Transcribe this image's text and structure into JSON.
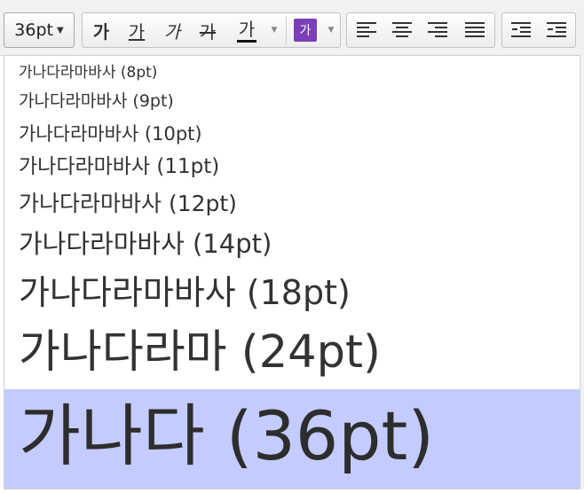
{
  "toolbar": {
    "font_size_value": "36pt",
    "bold_glyph": "가",
    "underline_glyph": "가",
    "italic_glyph": "가",
    "strike_glyph": "가",
    "font_color_glyph": "가",
    "bg_color_glyph": "가",
    "font_color": "#111111",
    "bg_color": "#7a3fb8"
  },
  "size_list": {
    "items": [
      {
        "label": "가나다라마바사 (8pt)",
        "selected": false
      },
      {
        "label": "가나다라마바사 (9pt)",
        "selected": false
      },
      {
        "label": "가나다라마바사 (10pt)",
        "selected": false
      },
      {
        "label": "가나다라마바사 (11pt)",
        "selected": false
      },
      {
        "label": "가나다라마바사 (12pt)",
        "selected": false
      },
      {
        "label": "가나다라마바사 (14pt)",
        "selected": false
      },
      {
        "label": "가나다라마바사 (18pt)",
        "selected": false
      },
      {
        "label": "가나다라마 (24pt)",
        "selected": false
      },
      {
        "label": "가나다 (36pt)",
        "selected": true
      }
    ],
    "selected_bg": "#c4cbff"
  }
}
